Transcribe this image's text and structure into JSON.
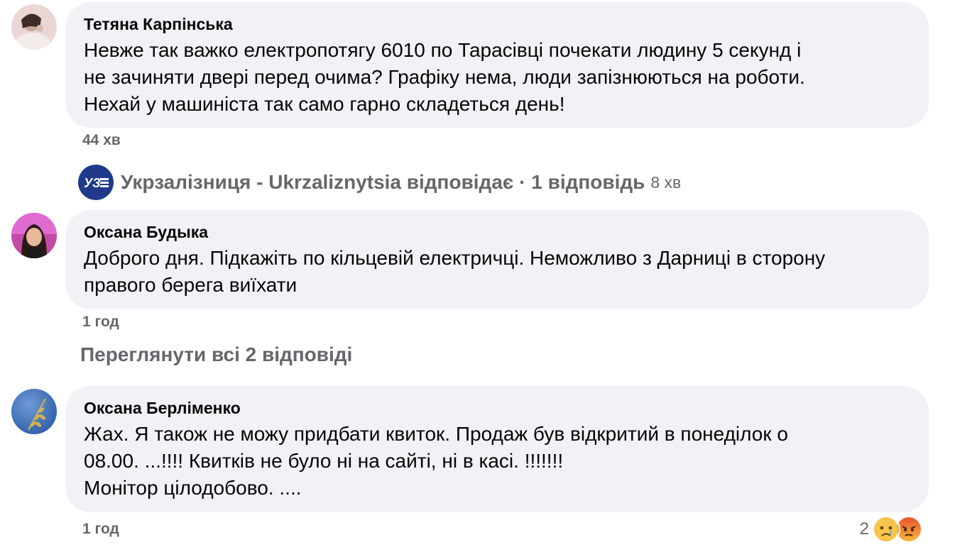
{
  "comments": [
    {
      "author": "Тетяна Карпінська",
      "text": "Невже так важко електропотягу 6010 по Тарасівці почекати людину 5 секунд і\nне зачиняти двері перед очима? Графіку нема, люди запізнюються на роботи.\nНехай у машиніста так само гарно складеться день!",
      "time": "44 хв"
    },
    {
      "author": "Оксана Будыка",
      "text": "Доброго дня. Підкажіть по кільцевій електричці. Неможливо з Дарниці в сторону\nправого берега виїхати",
      "time": "1 год"
    },
    {
      "author": "Оксана Берліменко",
      "text": "Жах. Я також не можу придбати квиток. Продаж був відкритий в понеділок о\n08.00. ...!!!! Квитків не було ні на сайті, ні в касі. !!!!!!!\nМонітор цілодобово. ....",
      "time": "1 год"
    }
  ],
  "reply_summary": {
    "label": "Укрзалізниця - Ukrzaliznytsia відповідає · 1 відповідь",
    "age": "8 хв",
    "logo_text": "УЗ"
  },
  "view_all_replies": "Переглянути всі 2 відповіді",
  "reactions": {
    "count": "2",
    "icons": [
      "sad-reaction-icon",
      "angry-reaction-icon"
    ]
  },
  "colors": {
    "bubble": "#f0f2f5",
    "secondary_text": "#65676b",
    "logo_blue": "#1f3a8a"
  }
}
